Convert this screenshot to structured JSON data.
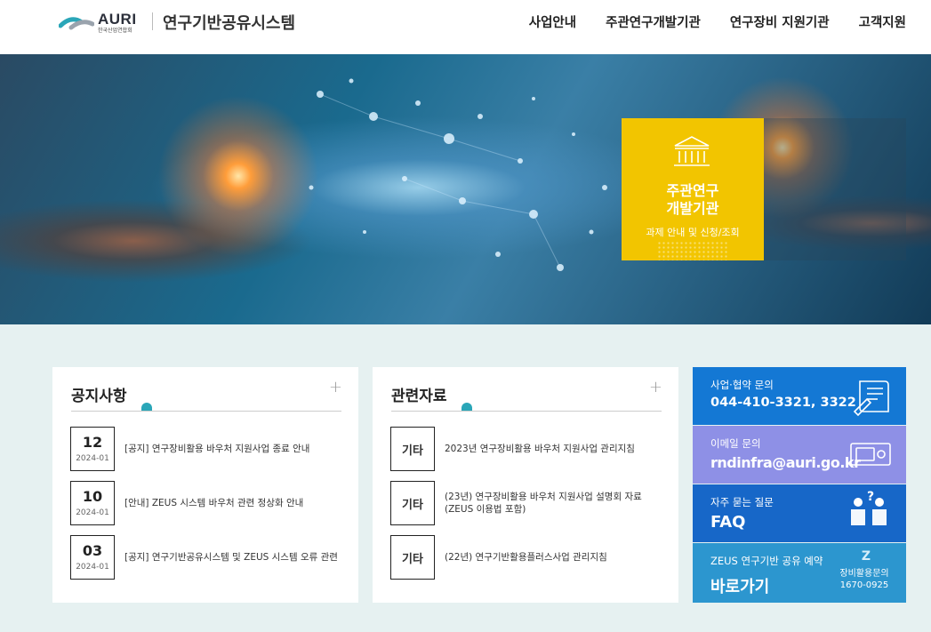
{
  "header": {
    "logo_text": "AURI",
    "logo_sub": "한국산업연합회",
    "site_title": "연구기반공유시스템",
    "nav": [
      "사업안내",
      "주관연구개발기관",
      "연구장비 지원기관",
      "고객지원"
    ]
  },
  "hero": {
    "card_title": "주관연구\n개발기관",
    "card_sub": "과제 안내 및 신청/조회"
  },
  "notice": {
    "title": "공지사항",
    "more": "+",
    "items": [
      {
        "day": "12",
        "ym": "2024-01",
        "text": "[공지] 연구장비활용 바우처 지원사업 종료 안내"
      },
      {
        "day": "10",
        "ym": "2024-01",
        "text": "[안내] ZEUS 시스템 바우처 관련 정상화 안내"
      },
      {
        "day": "03",
        "ym": "2024-01",
        "text": "[공지] 연구기반공유시스템 및 ZEUS 시스템 오류 관련"
      }
    ]
  },
  "references": {
    "title": "관련자료",
    "more": "+",
    "items": [
      {
        "tag": "기타",
        "text": "2023년 연구장비활용 바우처 지원사업 관리지침"
      },
      {
        "tag": "기타",
        "text": "(23년) 연구장비활용 바우처 지원사업 설명회 자료(ZEUS 이용법 포함)"
      },
      {
        "tag": "기타",
        "text": "(22년) 연구기반활용플러스사업 관리지침"
      }
    ]
  },
  "tiles": {
    "contact": {
      "label": "사업·협약 문의",
      "value": "044-410-3321, 3322"
    },
    "email": {
      "label": "이메일 문의",
      "value": "rndinfra@auri.go.kr"
    },
    "faq": {
      "label": "자주 묻는 질문",
      "value": "FAQ"
    },
    "zeus": {
      "label": "ZEUS 연구기반 공유 예약",
      "value": "바로가기",
      "side_icon": "Z",
      "side_label": "장비활용문의",
      "side_phone": "1670-0925"
    }
  },
  "colors": {
    "hero_card": "#f2c500",
    "tile_contact": "#1478d4",
    "tile_email": "#8e90e6",
    "tile_faq": "#1767c8",
    "tile_zeus": "#2c96cf",
    "accent": "#2aa6b8"
  }
}
